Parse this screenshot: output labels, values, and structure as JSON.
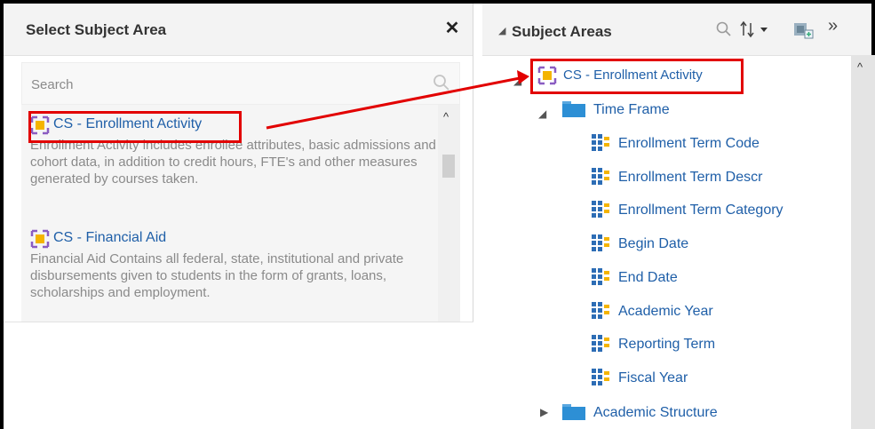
{
  "left_dialog": {
    "title": "Select Subject Area",
    "close_label": "✕",
    "search": {
      "placeholder": "Search",
      "value": ""
    },
    "subjects": [
      {
        "label": "CS - Enrollment Activity",
        "description": "Enrollment Activity includes enrollee attributes, basic admissions and cohort data, in addition to credit hours, FTE's and other measures generated by courses taken."
      },
      {
        "label": "CS - Financial Aid",
        "description": "Financial Aid Contains all federal, state, institutional and private disbursements given to students in the form of grants, loans, scholarships and employment."
      }
    ]
  },
  "right_panel": {
    "title": "Subject Areas",
    "sort_label": "↑↓ ▾",
    "more_label": "»",
    "tree": {
      "root": "CS - Enrollment Activity",
      "folders": [
        {
          "label": "Time Frame",
          "expanded": true,
          "columns": [
            "Enrollment Term Code",
            "Enrollment Term Descr",
            "Enrollment Term Category",
            "Begin Date",
            "End Date",
            "Academic Year",
            "Reporting Term",
            "Fiscal Year"
          ]
        },
        {
          "label": "Academic Structure",
          "expanded": false
        }
      ]
    }
  },
  "colors": {
    "highlight": "#e20000",
    "link": "#1f5fa8",
    "subject_icon": "#f4b400",
    "column_icon": "#2d6db5",
    "folder_icon": "#2d8fd5"
  }
}
